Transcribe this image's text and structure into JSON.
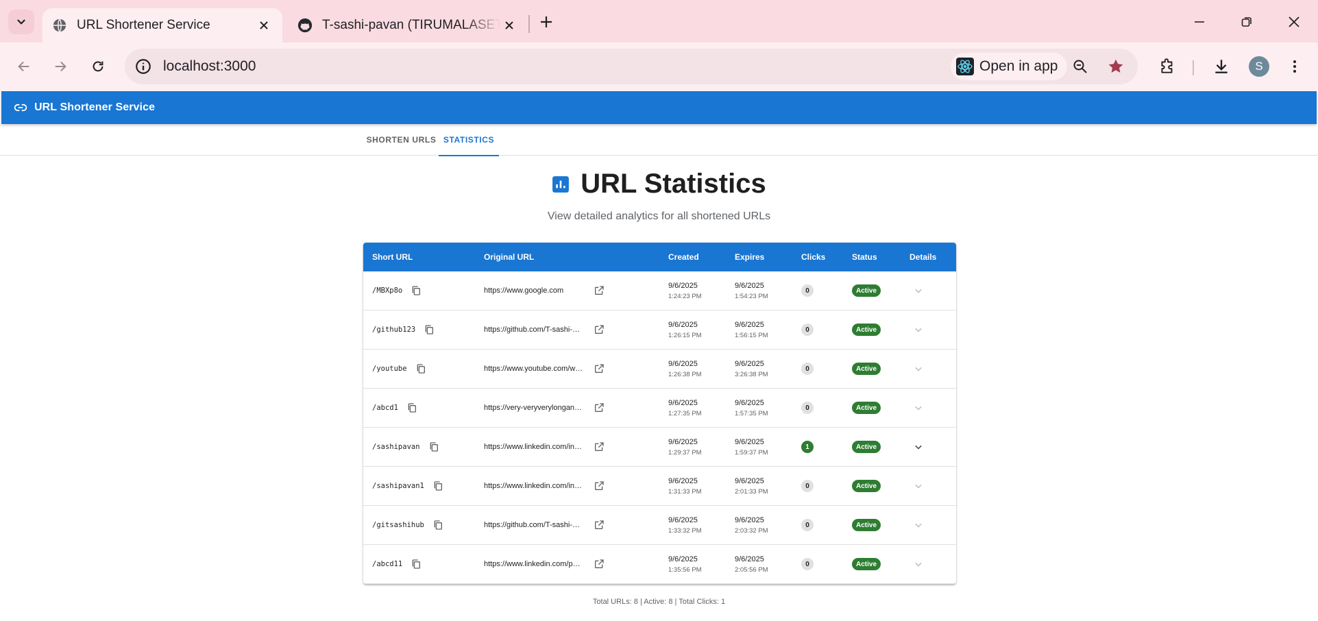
{
  "browser": {
    "tabs": [
      {
        "title": "URL Shortener Service",
        "favicon": "globe-icon",
        "active": true
      },
      {
        "title": "T-sashi-pavan (TIRUMALASETTY",
        "favicon": "github-icon",
        "active": false
      }
    ],
    "address": "localhost:3000",
    "open_in_app_label": "Open in app",
    "profile_initial": "S"
  },
  "app": {
    "title": "URL Shortener Service",
    "tabs": [
      "SHORTEN URLS",
      "STATISTICS"
    ],
    "active_tab": "STATISTICS",
    "heading": "URL Statistics",
    "subtitle": "View detailed analytics for all shortened URLs",
    "accent_color": "#1976d2",
    "status_color": "#2e7d32"
  },
  "table": {
    "columns": [
      "Short URL",
      "Original URL",
      "Created",
      "Expires",
      "Clicks",
      "Status",
      "Details"
    ],
    "rows": [
      {
        "short": "/MBXp8o",
        "original": "https://www.google.com",
        "created_date": "9/6/2025",
        "created_time": "1:24:23 PM",
        "expires_date": "9/6/2025",
        "expires_time": "1:54:23 PM",
        "clicks": "0",
        "status": "Active"
      },
      {
        "short": "/github123",
        "original": "https://github.com/T-sashi-pa...",
        "created_date": "9/6/2025",
        "created_time": "1:26:15 PM",
        "expires_date": "9/6/2025",
        "expires_time": "1:56:15 PM",
        "clicks": "0",
        "status": "Active"
      },
      {
        "short": "/youtube",
        "original": "https://www.youtube.com/wat...",
        "created_date": "9/6/2025",
        "created_time": "1:26:38 PM",
        "expires_date": "9/6/2025",
        "expires_time": "3:26:38 PM",
        "clicks": "0",
        "status": "Active"
      },
      {
        "short": "/abcd1",
        "original": "https://very-veryverylongand-...",
        "created_date": "9/6/2025",
        "created_time": "1:27:35 PM",
        "expires_date": "9/6/2025",
        "expires_time": "1:57:35 PM",
        "clicks": "0",
        "status": "Active"
      },
      {
        "short": "/sashipavan",
        "original": "https://www.linkedin.com/in/ti...",
        "created_date": "9/6/2025",
        "created_time": "1:29:37 PM",
        "expires_date": "9/6/2025",
        "expires_time": "1:59:37 PM",
        "clicks": "1",
        "status": "Active"
      },
      {
        "short": "/sashipavan1",
        "original": "https://www.linkedin.com/in/ti...",
        "created_date": "9/6/2025",
        "created_time": "1:31:33 PM",
        "expires_date": "9/6/2025",
        "expires_time": "2:01:33 PM",
        "clicks": "0",
        "status": "Active"
      },
      {
        "short": "/gitsashihub",
        "original": "https://github.com/T-sashi-pa...",
        "created_date": "9/6/2025",
        "created_time": "1:33:32 PM",
        "expires_date": "9/6/2025",
        "expires_time": "2:03:32 PM",
        "clicks": "0",
        "status": "Active"
      },
      {
        "short": "/abcd11",
        "original": "https://www.linkedin.com/pul...",
        "created_date": "9/6/2025",
        "created_time": "1:35:56 PM",
        "expires_date": "9/6/2025",
        "expires_time": "2:05:56 PM",
        "clicks": "0",
        "status": "Active"
      }
    ]
  },
  "footer": "Total URLs: 8 | Active: 8 | Total Clicks: 1"
}
